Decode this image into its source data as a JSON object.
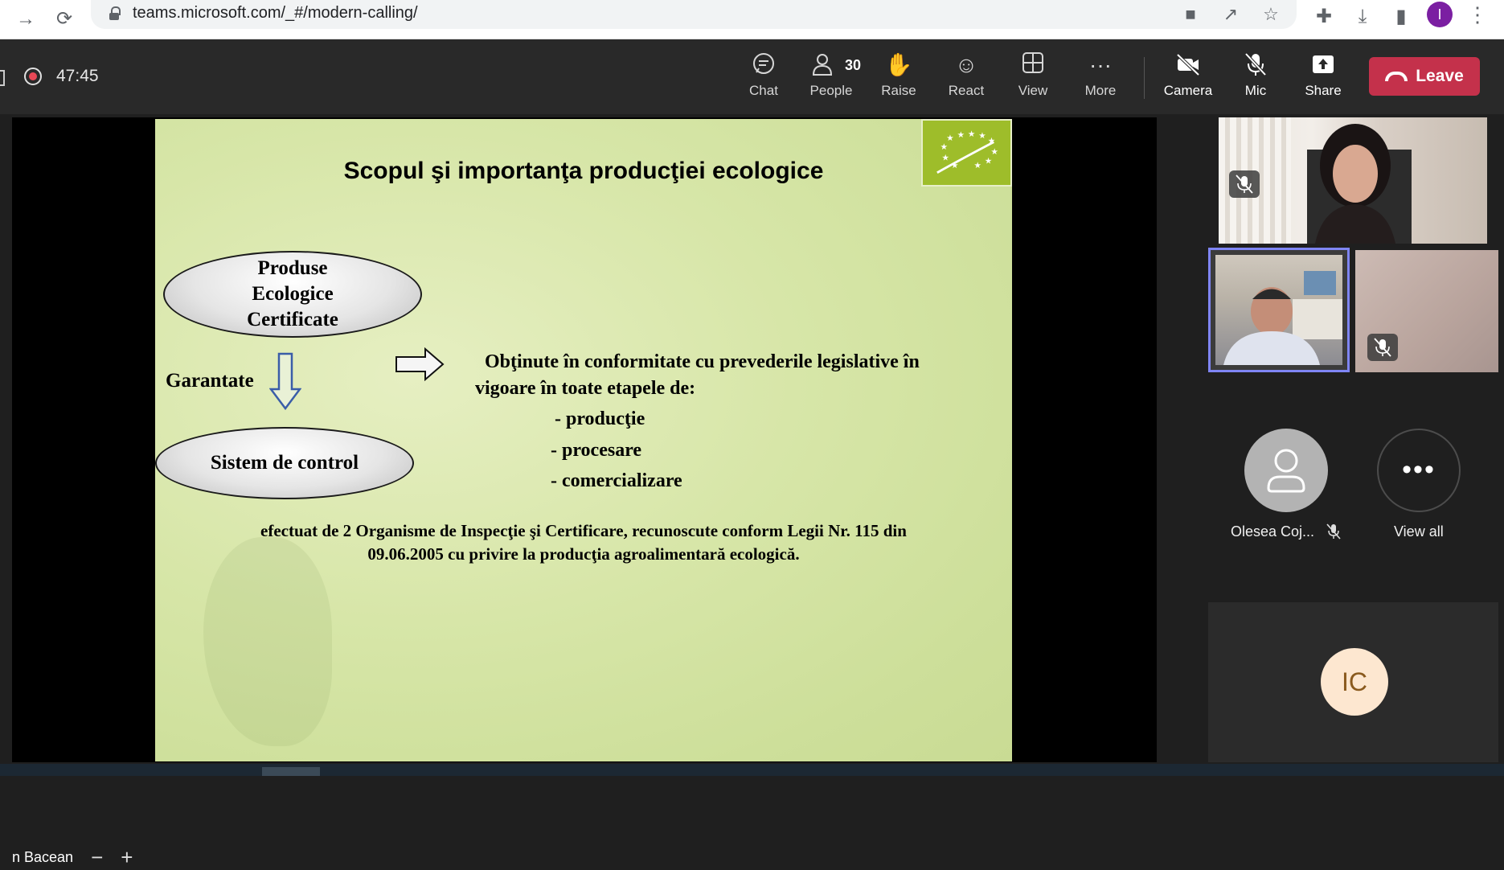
{
  "browser": {
    "url": "teams.microsoft.com/_#/modern-calling/",
    "profile_initial": "I"
  },
  "meeting": {
    "elapsed": "47:45",
    "toolbar": {
      "chat": "Chat",
      "people": "People",
      "people_count": "30",
      "raise": "Raise",
      "react": "React",
      "view": "View",
      "more": "More",
      "camera": "Camera",
      "mic": "Mic",
      "share": "Share",
      "leave": "Leave"
    },
    "presenter_name": "n Bacean"
  },
  "slide": {
    "title": "Scopul şi importanţa producţiei ecologice",
    "ellipse_top": [
      "Produse",
      "Ecologice",
      "Certificate"
    ],
    "garantate": "Garantate",
    "ellipse_bottom": "Sistem de control",
    "paragraph_line1": "Obţinute în conformitate cu prevederile legislative în",
    "paragraph_line2": "vigoare în  toate etapele de:",
    "bullets": [
      "- producţie",
      "-  procesare",
      "-  comercializare"
    ],
    "footer_line1": "efectuat de 2 Organisme de Inspecţie şi Certificare,  recunoscute conform Legii Nr. 115 din",
    "footer_line2": "09.06.2005 cu privire la producţia agroalimentară ecologică."
  },
  "gallery": {
    "participant_name": "Olesea Coj...",
    "view_all": "View all",
    "ic_initials": "IC"
  },
  "colors": {
    "leave_red": "#c4314b",
    "active_speaker": "#7f85f5",
    "eu_green": "#9ebd2a"
  }
}
